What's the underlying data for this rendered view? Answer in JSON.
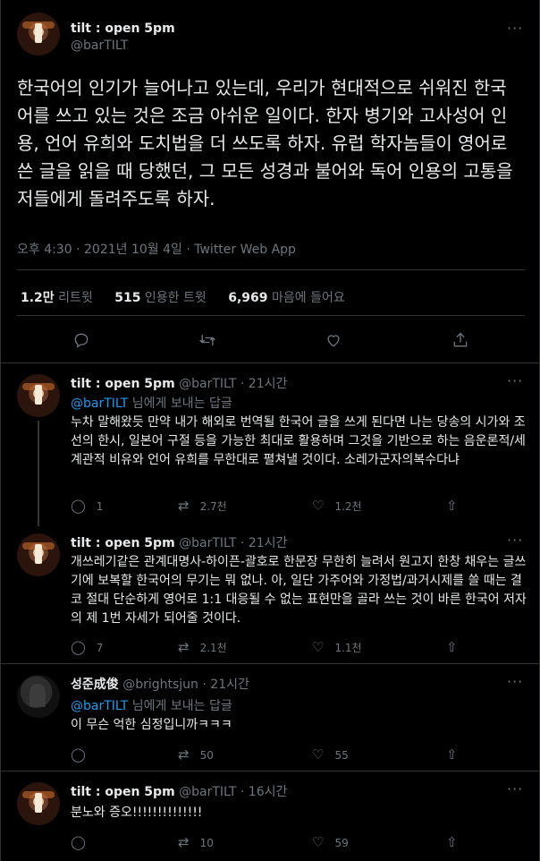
{
  "main_tweet": {
    "name": "tilt : open 5pm",
    "handle": "@barTILT",
    "text": "한국어의 인기가 늘어나고 있는데, 우리가 현대적으로 쉬워진 한국어를 쓰고 있는 것은 조금 아쉬운 일이다. 한자 병기와 고사성어 인용, 언어 유희와 도치법을 더 쓰도록 하자. 유럽 학자놈들이 영어로 쓴 글을 읽을 때 당했던, 그 모든 성경과 불어와 독어 인용의 고통을 저들에게 돌려주도록 하자.",
    "meta": "오후 4:30 · 2021년 10월 4일 · Twitter Web App",
    "stats": {
      "retweets_count": "1.2만",
      "retweets_label": "리트윗",
      "quotes_count": "515",
      "quotes_label": "인용한 트윗",
      "likes_count": "6,969",
      "likes_label": "마음에 들어요"
    },
    "more_label": "···"
  },
  "replies": [
    {
      "name": "tilt : open 5pm",
      "handle": "@barTILT",
      "time": "· 21시간",
      "reply_to_handle": "@barTILT",
      "reply_to_suffix": "님에게 보내는 답글",
      "text": "누차 말해왔듯 만약 내가 해외로 번역될 한국어 글을 쓰게 된다면 나는 당송의 시가와 조선의 한시, 일본어 구절 등을 가능한 최대로 활용하며 그것을 기반으로 하는 음운론적/세계관적 비유와 언어 유희를 무한대로 펼쳐낼 것이다. 소레가군자의복수다냐",
      "replies": "1",
      "retweets": "2.7천",
      "likes": "1.2천"
    },
    {
      "name": "tilt : open 5pm",
      "handle": "@barTILT",
      "time": "· 21시간",
      "text": "개쓰레기같은 관계대명사-하이픈-괄호로 한문장 무한히 늘려서 원고지 한창 채우는 글쓰기에 보복할 한국어의 무기는 뭐 없나. 아, 일단 가주어와 가정법/과거시제를 쓸 때는 결코 절대 단순하게 영어로 1:1 대응될 수 없는 표현만을 골라 쓰는 것이 바른 한국어 저자의 제 1번 자세가 되어줄 것이다.",
      "replies": "7",
      "retweets": "2.1천",
      "likes": "1.1천"
    },
    {
      "name": "성준成俊",
      "handle": "@brightsjun",
      "time": "· 21시간",
      "reply_to_handle": "@barTILT",
      "reply_to_suffix": "님에게 보내는 답글",
      "text": "이 무슨 억한 심정입니까ㅋㅋㅋ",
      "replies": "",
      "retweets": "50",
      "likes": "55"
    },
    {
      "name": "tilt : open 5pm",
      "handle": "@barTILT",
      "time": "· 16시간",
      "text": "분노와 증오!!!!!!!!!!!!!!",
      "replies": "",
      "retweets": "10",
      "likes": "59"
    }
  ],
  "icons": [
    "reply-icon",
    "retweet-icon",
    "like-icon",
    "share-icon",
    "more-icon"
  ],
  "colors": {
    "background": "#000000",
    "link": "#1d9bf0",
    "muted": "#6e767d",
    "text": "#e7e9ea",
    "border": "#2f3336"
  }
}
